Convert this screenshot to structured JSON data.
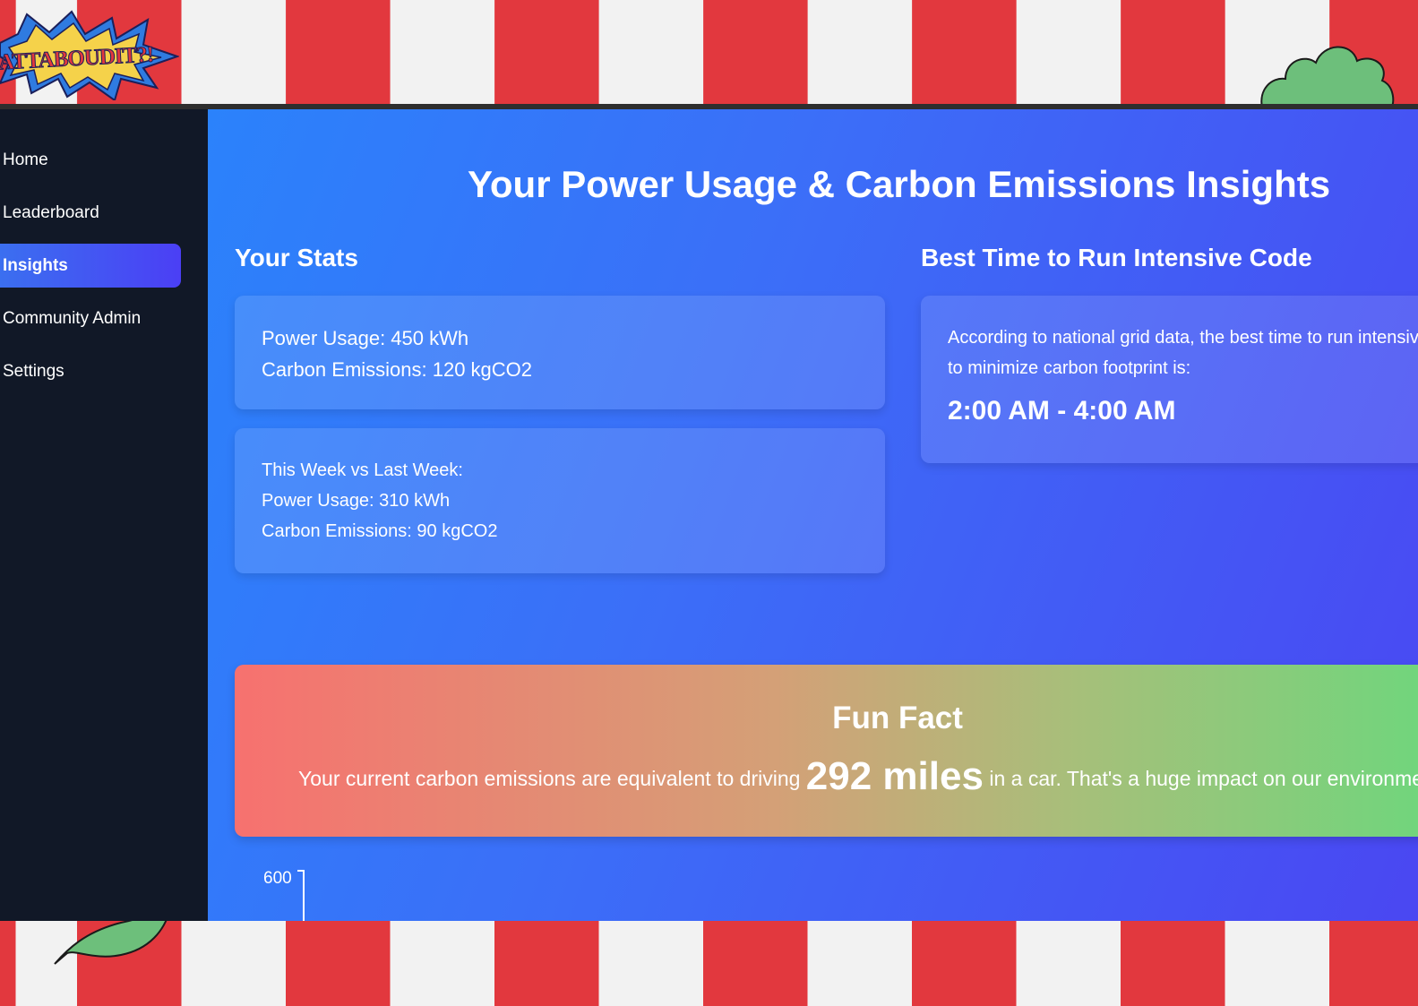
{
  "brand": {
    "logo_text": "ATTABOUDIT?!"
  },
  "sidebar": {
    "items": [
      {
        "label": "Home",
        "active": false
      },
      {
        "label": "Leaderboard",
        "active": false
      },
      {
        "label": "Insights",
        "active": true
      },
      {
        "label": "Community Admin",
        "active": false
      },
      {
        "label": "Settings",
        "active": false
      }
    ]
  },
  "main": {
    "title": "Your Power Usage & Carbon Emissions Insights",
    "stats": {
      "heading": "Your Stats",
      "card1": {
        "power": "Power Usage: 450 kWh",
        "carbon": "Carbon Emissions: 120 kgCO2"
      },
      "card2": {
        "compare": "This Week vs Last Week:",
        "power": "Power Usage: 310 kWh",
        "carbon": "Carbon Emissions: 90 kgCO2"
      }
    },
    "best_time": {
      "heading": "Best Time to Run Intensive Code",
      "line1": "According to national grid data, the best time to run intensive code",
      "line2": "to minimize carbon footprint is:",
      "value": "2:00 AM - 4:00 AM"
    },
    "fun_fact": {
      "heading": "Fun Fact",
      "prefix": "Your current carbon emissions are equivalent to driving",
      "highlight": "292 miles",
      "suffix": "in a car. That's a huge impact on our environment!"
    },
    "chart": {
      "y_tick": "600"
    }
  },
  "colors": {
    "sidebar_bg": "#111827",
    "accent": "#4b3ff5",
    "stripe_red": "#e2383e",
    "stripe_white": "#f2f2f2"
  }
}
